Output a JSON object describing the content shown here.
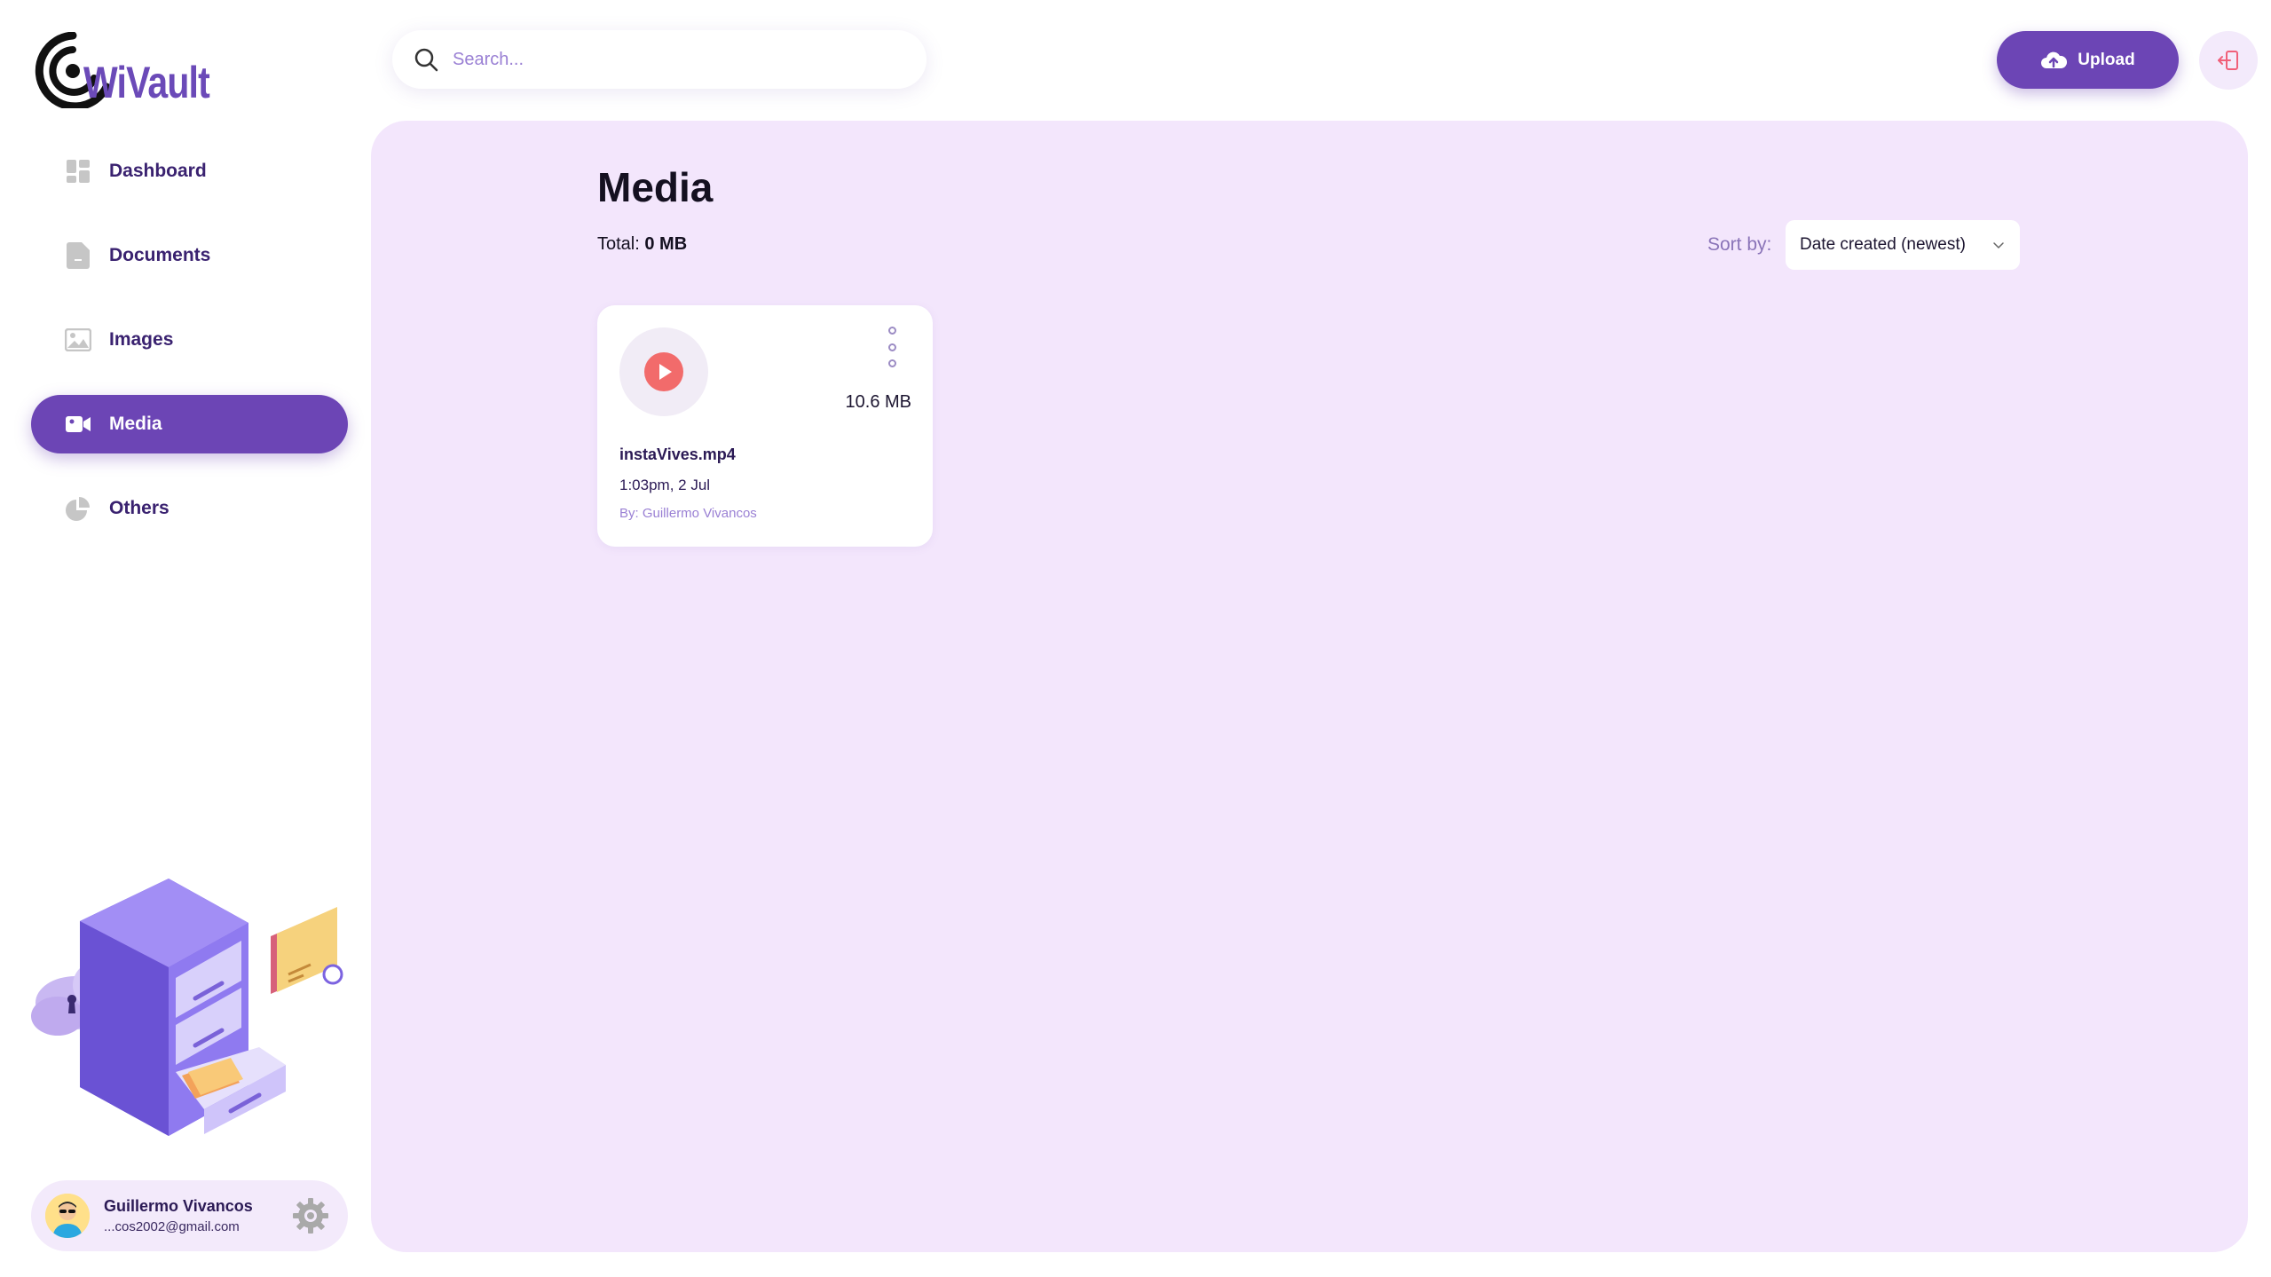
{
  "app": {
    "brand": "WiVault",
    "brand_color": "#6c45b5"
  },
  "sidebar": {
    "items": [
      {
        "label": "Dashboard",
        "icon": "dashboard-icon",
        "active": false
      },
      {
        "label": "Documents",
        "icon": "document-icon",
        "active": false
      },
      {
        "label": "Images",
        "icon": "image-icon",
        "active": false
      },
      {
        "label": "Media",
        "icon": "video-icon",
        "active": true
      },
      {
        "label": "Others",
        "icon": "pie-chart-icon",
        "active": false
      }
    ]
  },
  "user": {
    "name": "Guillermo Vivancos",
    "email": "...cos2002@gmail.com"
  },
  "search": {
    "placeholder": "Search..."
  },
  "header": {
    "upload_label": "Upload"
  },
  "main": {
    "title": "Media",
    "total_label": "Total:",
    "total_value": "0 MB",
    "sort_label": "Sort by:",
    "sort_value": "Date created (newest)"
  },
  "files": [
    {
      "name": "instaVives.mp4",
      "size": "10.6 MB",
      "date": "1:03pm, 2 Jul",
      "owner": "By: Guillermo Vivancos",
      "icon": "play-icon"
    }
  ]
}
